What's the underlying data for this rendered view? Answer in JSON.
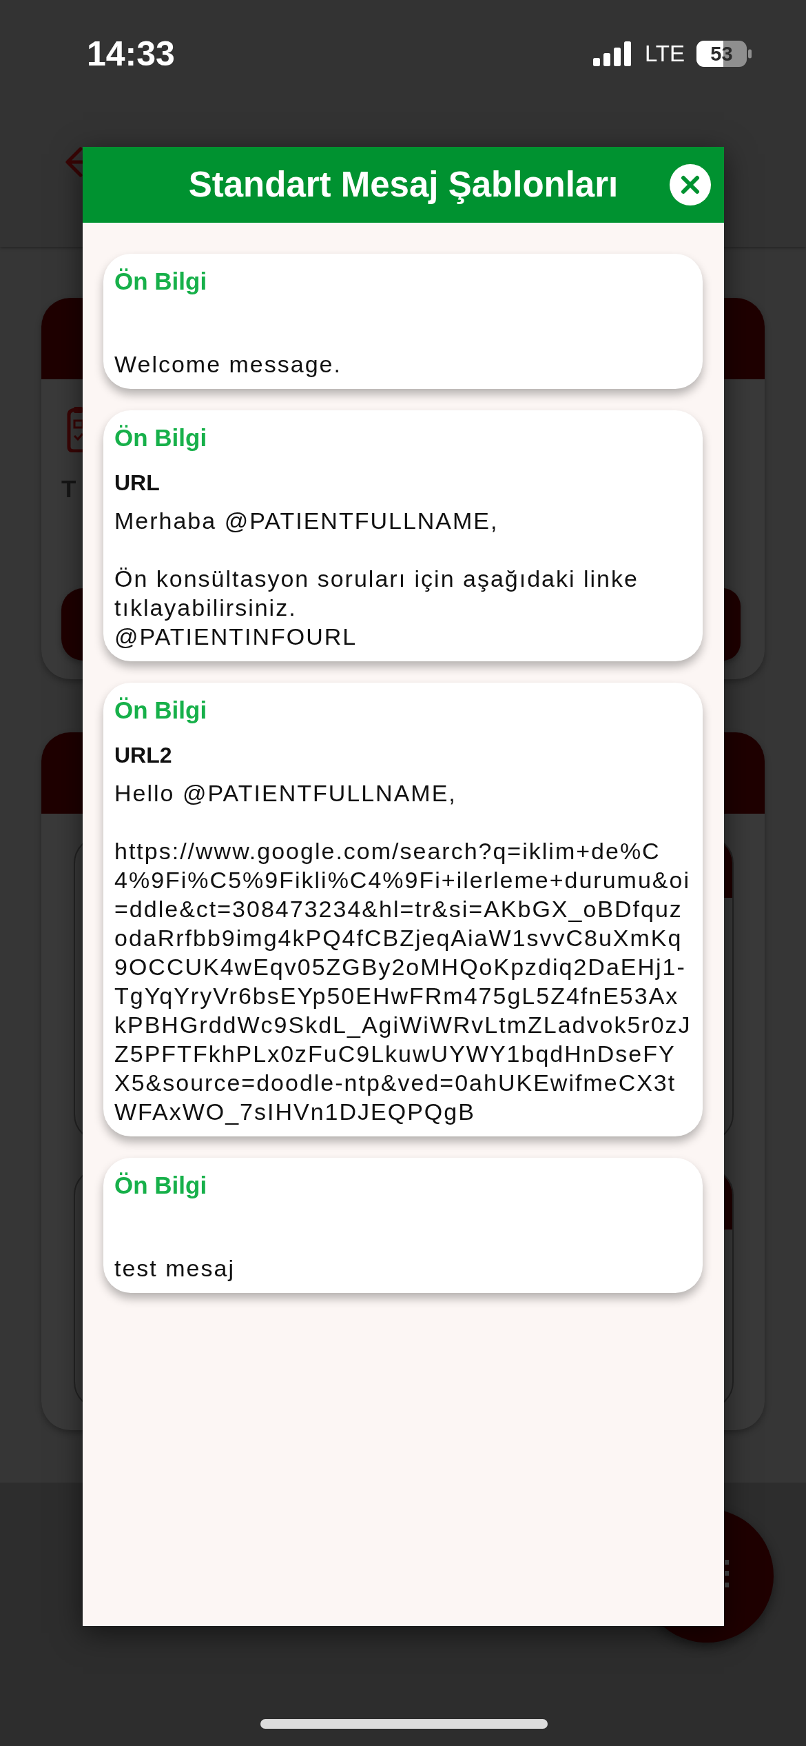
{
  "status_bar": {
    "time": "14:33",
    "network": "LTE",
    "battery": "53"
  },
  "background": {
    "card_label": "T"
  },
  "modal": {
    "title": "Standart Mesaj Şablonları",
    "templates": [
      {
        "category": "Ön Bilgi",
        "message": "Welcome message."
      },
      {
        "category": "Ön Bilgi",
        "title": "URL",
        "message": "Merhaba @PATIENTFULLNAME,\n\nÖn konsültasyon soruları için aşağıdaki linke tıklayabilirsiniz.\n@PATIENTINFOURL"
      },
      {
        "category": "Ön Bilgi",
        "title": "URL2",
        "message": "Hello @PATIENTFULLNAME,\n\nhttps://www.google.com/search?q=iklim+de%C4%9Fi%C5%9Fikli%C4%9Fi+ilerleme+durumu&oi=ddle&ct=308473234&hl=tr&si=AKbGX_oBDfquzodaRrfbb9img4kPQ4fCBZjeqAiaW1svvC8uXmKq9OCCUK4wEqv05ZGBy2oMHQoKpzdiq2DaEHj1-TgYqYryVr6bsEYp50EHwFRm475gL5Z4fnE53AxkPBHGrddWc9SkdL_AgiWiWRvLtmZLadvok5r0zJZ5PFTFkhPLx0zFuC9LkuwUYWY1bqdHnDseFYX5&source=doodle-ntp&ved=0ahUKEwifmeCX3tWFAxWO_7sIHVn1DJEQPQgB"
      },
      {
        "category": "Ön Bilgi",
        "message": "test mesaj"
      }
    ]
  }
}
